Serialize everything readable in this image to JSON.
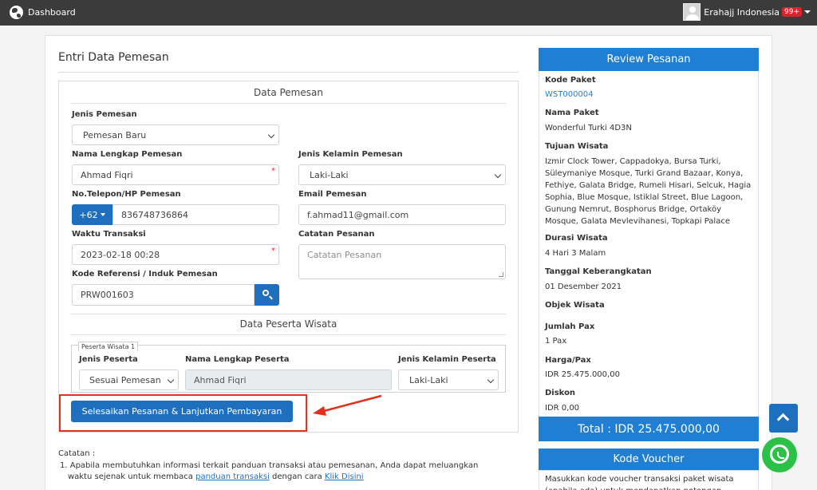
{
  "topbar": {
    "title": "Dashboard",
    "user_name": "Erahajj Indonesia",
    "notification_count": "99+"
  },
  "form": {
    "title": "Entri Data Pemesan",
    "section_pemesan": "Data Pemesan",
    "jenis_pemesan": {
      "label": "Jenis Pemesan",
      "value": "Pemesan Baru"
    },
    "nama_lengkap": {
      "label": "Nama Lengkap Pemesan",
      "value": "Ahmad Fiqri"
    },
    "jenis_kelamin": {
      "label": "Jenis Kelamin Pemesan",
      "value": "Laki-Laki"
    },
    "telepon": {
      "label": "No.Telepon/HP Pemesan",
      "country_code": "+62",
      "value": "836748736864"
    },
    "email": {
      "label": "Email Pemesan",
      "value": "f.ahmad11@gmail.com"
    },
    "waktu": {
      "label": "Waktu Transaksi",
      "value": "2023-02-18 00:28"
    },
    "catatan": {
      "label": "Catatan Pesanan",
      "placeholder": "Catatan Pesanan"
    },
    "kode_referensi": {
      "label": "Kode Referensi / Induk Pemesan",
      "value": "PRW001603"
    },
    "required_mark": "*",
    "section_peserta": "Data Peserta Wisata",
    "peserta": {
      "legend": "Peserta Wisata 1",
      "jenis_label": "Jenis Peserta",
      "jenis_value": "Sesuai Pemesan",
      "nama_label": "Nama Lengkap Peserta",
      "nama_value": "Ahmad Fiqri",
      "kelamin_label": "Jenis Kelamin Peserta",
      "kelamin_value": "Laki-Laki"
    },
    "submit_label": "Selesaikan Pesanan & Lanjutkan Pembayaran"
  },
  "notes": {
    "title": "Catatan :",
    "item1_num": "1.",
    "item1_line1": "Apabila membutuhkan informasi terkait panduan transaksi atau pemesanan, Anda dapat meluangkan",
    "item1_line2_a": "waktu sejenak untuk membaca ",
    "item1_link1": "panduan transaksi",
    "item1_line2_b": " dengan cara ",
    "item1_link2": "Klik Disini"
  },
  "review": {
    "title": "Review Pesanan",
    "kode_paket_label": "Kode Paket",
    "kode_paket_value": "WST000004",
    "nama_paket_label": "Nama Paket",
    "nama_paket_value": "Wonderful Turki 4D3N",
    "tujuan_label": "Tujuan Wisata",
    "tujuan_value": "Izmir Clock Tower, Cappadokya, Bursa Turki, Süleymaniye Mosque, Turki Grand Bazaar, Konya, Fethiye, Galata Bridge, Rumeli Hisari, Selcuk, Hagia Sophia, Blue Mosque, Istiklal Street, Blue Lagoon, Gunung Nemrut, Bosphorus Bridge, Ortaköy Mosque, Galata Mevlevihanesi, Topkapi Palace",
    "durasi_label": "Durasi Wisata",
    "durasi_value": "4 Hari 3 Malam",
    "tanggal_label": "Tanggal Keberangkatan",
    "tanggal_value": "01 Desember 2021",
    "objek_label": "Objek Wisata",
    "pax_label": "Jumlah Pax",
    "pax_value": "1 Pax",
    "harga_label": "Harga/Pax",
    "harga_value": "IDR 25.475.000,00",
    "diskon_label": "Diskon",
    "diskon_value": "IDR 0,00",
    "total": "Total : IDR 25.475.000,00"
  },
  "voucher": {
    "title": "Kode Voucher",
    "text": "Masukkan kode voucher transaksi paket wisata (apabila ada) untuk mendapatkan potongan"
  }
}
